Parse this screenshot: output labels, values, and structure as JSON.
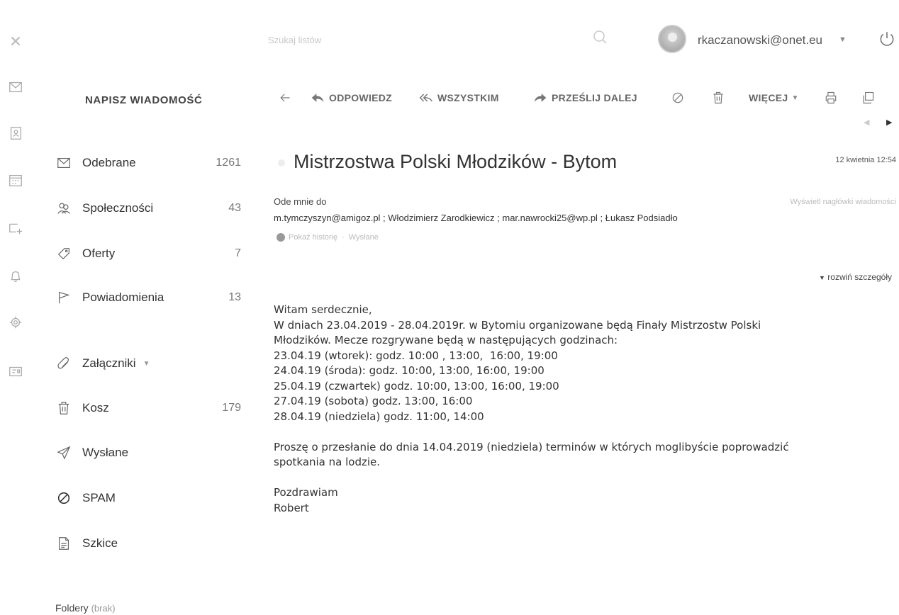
{
  "app": {
    "search_placeholder": "Szukaj listów",
    "user_email": "rkaczanowski@onet.eu"
  },
  "rail_icons": [
    "close-icon",
    "mail-icon",
    "contacts-icon",
    "calendar-icon",
    "new-event-icon",
    "notifications-icon",
    "settings-icon",
    "cards-icon"
  ],
  "compose_label": "NAPISZ WIADOMOŚĆ",
  "folders": [
    {
      "label": "Odebrane",
      "count": "1261",
      "icon": "inbox-icon"
    },
    {
      "label": "Społeczności",
      "count": "43",
      "icon": "community-icon"
    },
    {
      "label": "Oferty",
      "count": "7",
      "icon": "tag-icon"
    },
    {
      "label": "Powiadomienia",
      "count": "13",
      "icon": "flag-icon"
    },
    {
      "label": "Załączniki",
      "count": "",
      "icon": "paperclip-icon"
    },
    {
      "label": "Kosz",
      "count": "179",
      "icon": "trash-icon"
    },
    {
      "label": "Wysłane",
      "count": "",
      "icon": "send-icon"
    },
    {
      "label": "SPAM",
      "count": "",
      "icon": "spam-icon"
    },
    {
      "label": "Szkice",
      "count": "",
      "icon": "draft-icon"
    }
  ],
  "folders_section": {
    "label": "Foldery",
    "note": "(brak)"
  },
  "toolbar": {
    "reply": "ODPOWIEDZ",
    "reply_all": "WSZYSTKIM",
    "forward": "PRZEŚLIJ DALEJ",
    "more": "WIĘCEJ"
  },
  "message": {
    "subject": "Mistrzostwa Polski Młodzików - Bytom",
    "date": "12 kwietnia 12:54",
    "from_line": "Ode mnie do",
    "show_headers": "Wyświetl nagłówki wiadomości",
    "recipients": "m.tymczyszyn@amigoz.pl ; Włodzimierz Zarodkiewicz ; mar.nawrocki25@wp.pl ; Łukasz Podsiadło",
    "history_label": "Pokaż historię",
    "sent_label": "Wysłane",
    "expand_details": "rozwiń szczegóły",
    "body": [
      "Witam serdecznie,",
      "W dniach 23.04.2019 - 28.04.2019r. w Bytomiu organizowane będą Finały Mistrzostw Polski",
      "Młodzików. Mecze rozgrywane będą w następujących godzinach:",
      "23.04.19 (wtorek): godz. 10:00 , 13:00,  16:00, 19:00",
      "24.04.19 (środa): godz. 10:00, 13:00, 16:00, 19:00",
      "25.04.19 (czwartek) godz. 10:00, 13:00, 16:00, 19:00",
      "27.04.19 (sobota) godz. 13:00, 16:00",
      "28.04.19 (niedziela) godz. 11:00, 14:00",
      "",
      "Proszę o przesłanie do dnia 14.04.2019 (niedziela) terminów w których moglibyście poprowadzić",
      "spotkania na lodzie.",
      "",
      "Pozdrawiam",
      "Robert"
    ]
  }
}
